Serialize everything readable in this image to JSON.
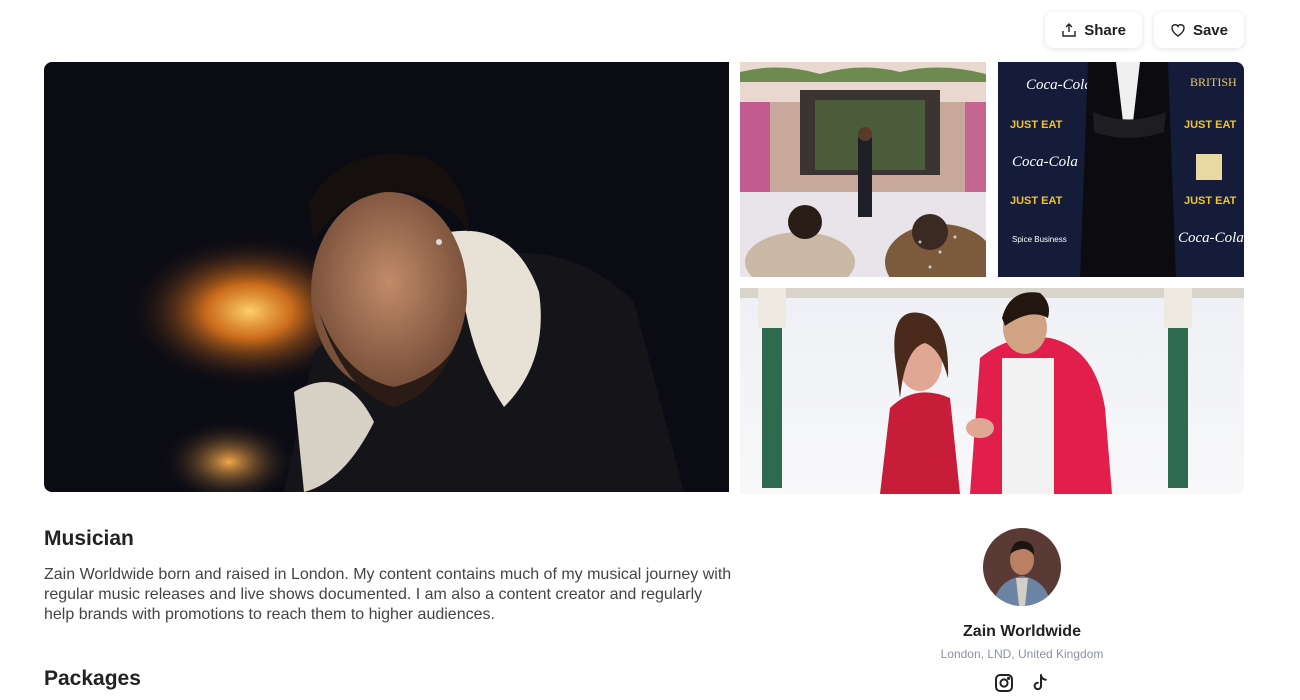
{
  "actions": {
    "share_label": "Share",
    "save_label": "Save"
  },
  "gallery": {
    "sponsor_texts": [
      "Coca-Cola",
      "JUST EAT",
      "BRITISH",
      "Spice Business"
    ]
  },
  "profile_section": {
    "title": "Musician",
    "bio": "Zain Worldwide born and raised in London. My content contains much of my musical journey with regular music releases and live shows documented. I am also a content creator and regularly help brands with promotions to reach them to higher audiences."
  },
  "packages": {
    "title": "Packages"
  },
  "creator": {
    "name": "Zain Worldwide",
    "location": "London, LND, United Kingdom",
    "socials": [
      "instagram-icon",
      "tiktok-icon"
    ]
  },
  "colors": {
    "muted": "#8b92a8",
    "crimson": "#d81f3b"
  }
}
